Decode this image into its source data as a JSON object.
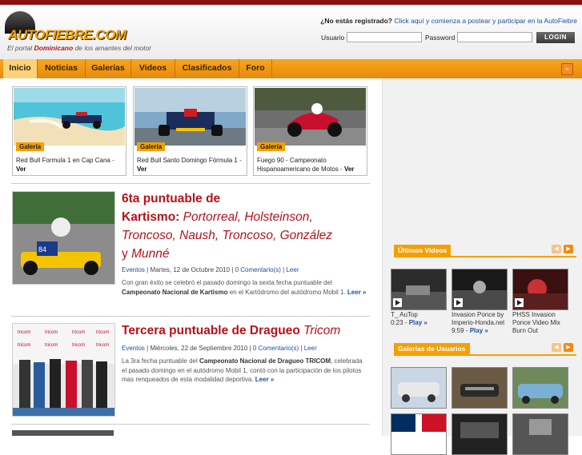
{
  "header": {
    "logo_text": "AUTOFIEBRE.COM",
    "tagline_pre": "El portal ",
    "tagline_brand": "Dominicano",
    "tagline_post": " de los amantes del motor",
    "register_question": "¿No estás registrado?",
    "register_link": "Click aquí y comienza a postear y participar en la AutoFiebre",
    "user_label": "Usuario",
    "password_label": "Password",
    "login_button": "LOGIN"
  },
  "nav": {
    "items": [
      "Inicio",
      "Noticias",
      "Galerías",
      "Videos",
      "Clasificados",
      "Foro"
    ],
    "active": "Inicio",
    "rss_icon": "rss-icon"
  },
  "galleries": [
    {
      "tag": "Galería",
      "caption": "Red Bull Formula 1 en Cap Cana - ",
      "more": "Ver"
    },
    {
      "tag": "Galería",
      "caption": "Red Bull Santo Domingo Fórmula 1 - ",
      "more": "Ver"
    },
    {
      "tag": "Galería",
      "caption": "Fuego 90 - Campeonato Hispanoamericano de Motos - ",
      "more": "Ver"
    }
  ],
  "articles": [
    {
      "title_line1": "6ta puntuable de",
      "title_line2_pre": "Kartismo: ",
      "title_line2_names": "Portorreal, Holsteinson,",
      "title_line3": "Troncoso, Naush, Troncoso, González",
      "title_line4_pre": "y ",
      "title_line4_name": "Munné",
      "category": "Eventos",
      "date": "Martes, 12 de Octubre 2010",
      "comments": "0 Comentario(s)",
      "read": "Leer",
      "body_pre": "Con gran éxito se celebró el pasado domingo la sexta fecha puntuable del ",
      "body_bold": "Campeonato Nacional de Kartismo",
      "body_post": " en el Kartódromo del autódromo Mobil 1. ",
      "more": "Leer »"
    },
    {
      "title_pre": "Tercera puntuable de Dragueo ",
      "title_name": "Tricom",
      "category": "Eventos",
      "date": "Miércoles, 22 de Septiembre 2010",
      "comments": "0 Comentario(s)",
      "read": "Leer",
      "body_pre": "La 3ra fecha puntuable del ",
      "body_bold": "Campeonato Nacional de Dragueo TRICOM",
      "body_post": ", celebrada el pasado domingo en el autódromo Mobil 1, contó con la participación de los pilotos mas renqueados de esta modalidad deportiva. ",
      "more": "Leer »"
    }
  ],
  "sidebar": {
    "videos_title": "Últimos Videos",
    "videos": [
      {
        "title": "T_ AuTop",
        "meta": "0:23 - ",
        "play": "Play »"
      },
      {
        "title": "Invasion Ponce by Imperio-Honda.net",
        "meta": "9:59 - ",
        "play": "Play »"
      },
      {
        "title": "PHSS Invasion Ponce Video Mix Burn Out",
        "meta": "",
        "play": ""
      }
    ],
    "users_title": "Galerías de Usuarios"
  }
}
